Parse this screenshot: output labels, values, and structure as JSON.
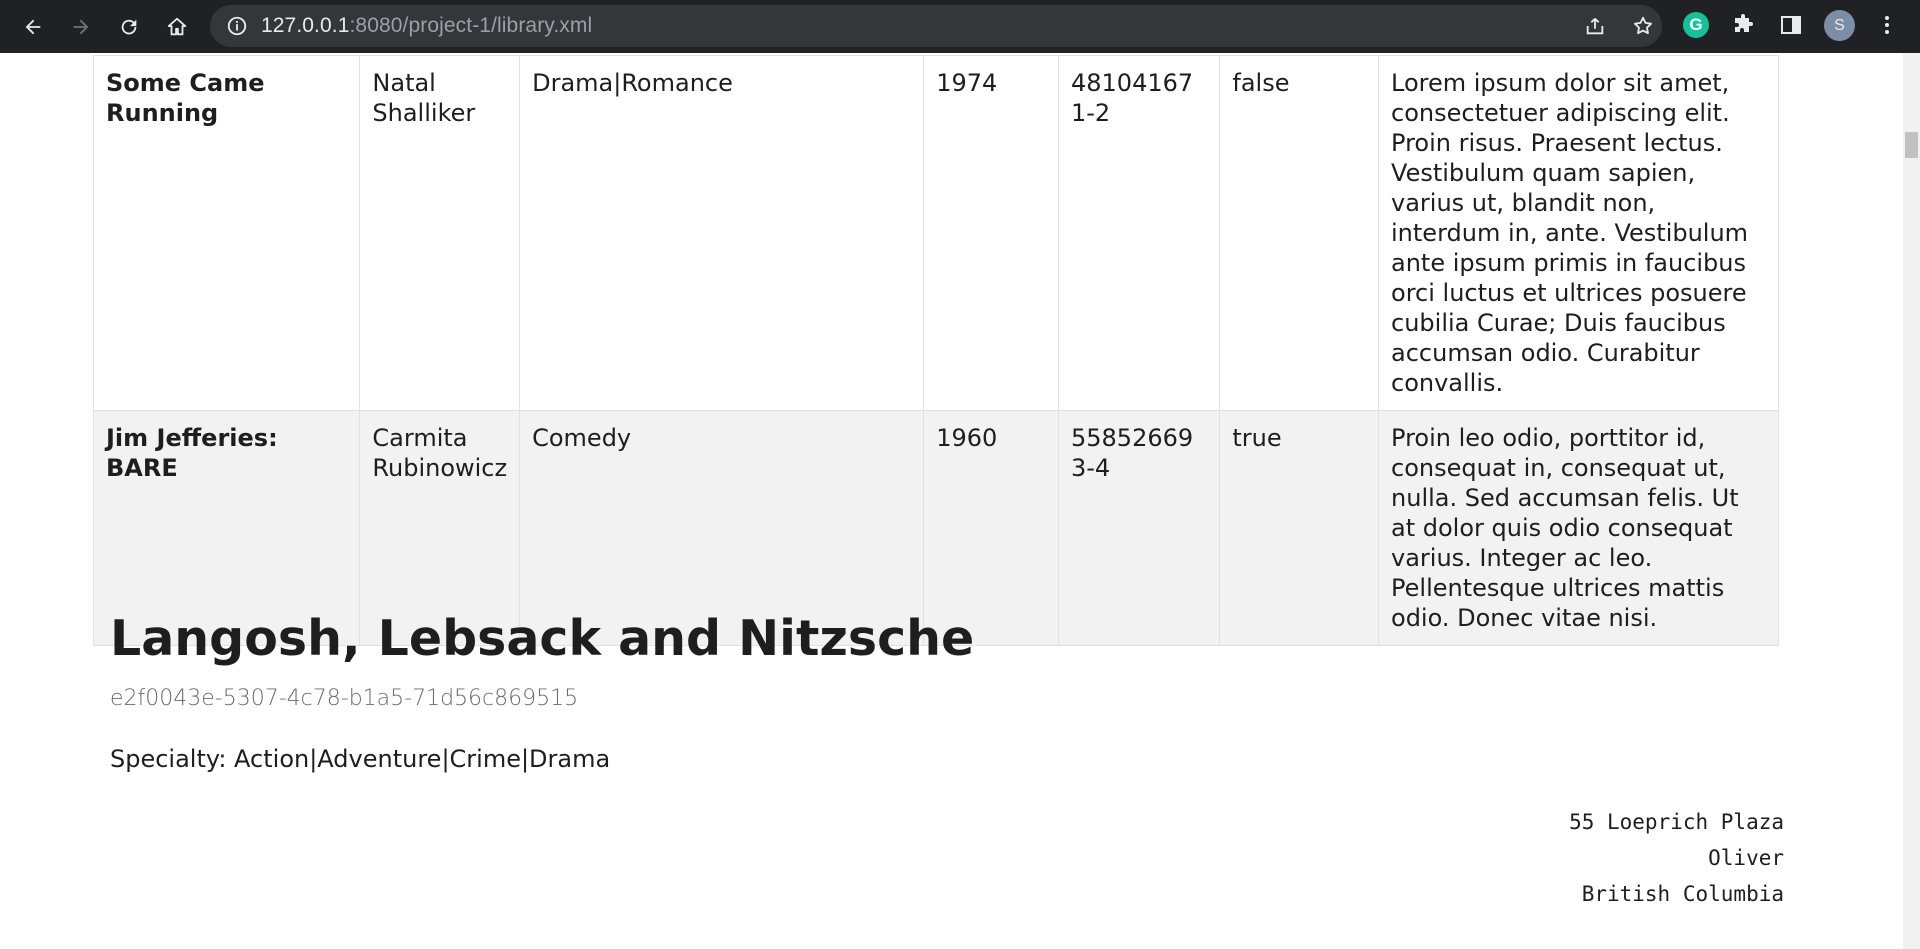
{
  "browser": {
    "url_host": "127.0.0.1",
    "url_rest": ":8080/project-1/library.xml",
    "profile_initial": "S",
    "grammarly_letter": "G"
  },
  "films": [
    {
      "title": "Some Came Running",
      "director": "Natal Shalliker",
      "genres": "Drama|Romance",
      "year": "1974",
      "isbn": "481041671-2",
      "available": "false",
      "description": "Lorem ipsum dolor sit amet, consectetuer adipiscing elit. Proin risus. Praesent lectus. Vestibulum quam sapien, varius ut, blandit non, interdum in, ante. Vestibulum ante ipsum primis in faucibus orci luctus et ultrices posuere cubilia Curae; Duis faucibus accumsan odio. Curabitur convallis."
    },
    {
      "title": "Jim Jefferies: BARE",
      "director": "Carmita Rubinowicz",
      "genres": "Comedy",
      "year": "1960",
      "isbn": "558526693-4",
      "available": "true",
      "description": "Proin leo odio, porttitor id, consequat in, consequat ut, nulla. Sed accumsan felis. Ut at dolor quis odio consequat varius. Integer ac leo. Pellentesque ultrices mattis odio. Donec vitae nisi."
    }
  ],
  "library": {
    "name": "Langosh, Lebsack and Nitzsche",
    "id": "e2f0043e-5307-4c78-b1a5-71d56c869515",
    "specialty": "Specialty: Action|Adventure|Crime|Drama",
    "address_line1": "55 Loeprich Plaza",
    "address_line2": "Oliver",
    "address_line3": "British Columbia"
  }
}
